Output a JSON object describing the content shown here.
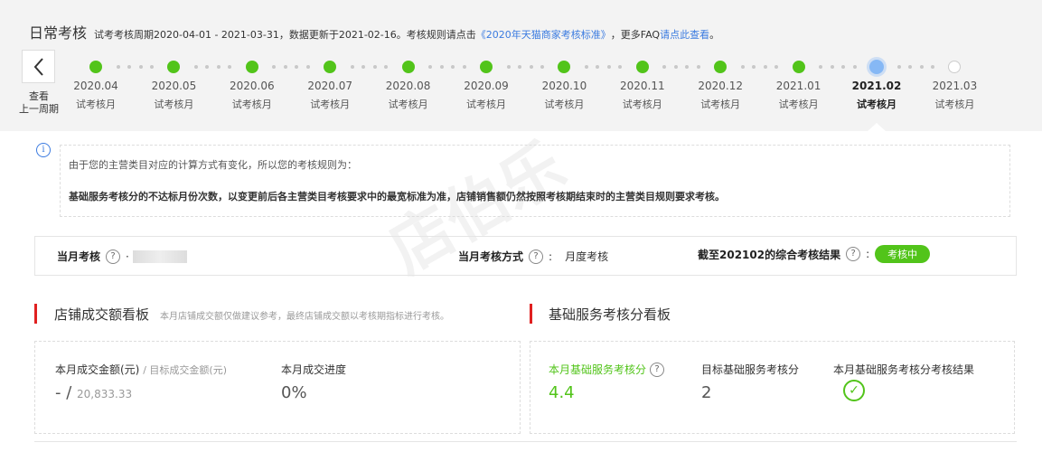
{
  "header": {
    "title": "日常考核",
    "desc_prefix": "试考考核周期2020-04-01 - 2021-03-31，数据更新于2021-02-16。考核规则请点击",
    "link_rules": "《2020年天猫商家考核标准》",
    "desc_mid": "，更多FAQ",
    "link_faq": "请点此查看",
    "desc_end": "。"
  },
  "back": {
    "line1": "查看",
    "line2": "上一周期"
  },
  "timeline": [
    {
      "month": "2020.04",
      "sub": "试考核月",
      "state": "done"
    },
    {
      "month": "2020.05",
      "sub": "试考核月",
      "state": "done"
    },
    {
      "month": "2020.06",
      "sub": "试考核月",
      "state": "done"
    },
    {
      "month": "2020.07",
      "sub": "试考核月",
      "state": "done"
    },
    {
      "month": "2020.08",
      "sub": "试考核月",
      "state": "done"
    },
    {
      "month": "2020.09",
      "sub": "试考核月",
      "state": "done"
    },
    {
      "month": "2020.10",
      "sub": "试考核月",
      "state": "done"
    },
    {
      "month": "2020.11",
      "sub": "试考核月",
      "state": "done"
    },
    {
      "month": "2020.12",
      "sub": "试考核月",
      "state": "done"
    },
    {
      "month": "2021.01",
      "sub": "试考核月",
      "state": "done"
    },
    {
      "month": "2021.02",
      "sub": "试考核月",
      "state": "current"
    },
    {
      "month": "2021.03",
      "sub": "试考核月",
      "state": "future"
    }
  ],
  "info": {
    "line1": "由于您的主营类目对应的计算方式有变化，所以您的考核规则为：",
    "line2": "基础服务考核分的不达标月份次数，以变更前后各主营类目考核要求中的最宽标准为准，店铺销售额仍然按照考核期结束时的主营类目规则要求考核。"
  },
  "stats": {
    "month_check": "当月考核",
    "month_value": "·",
    "mode_label": "当月考核方式",
    "mode_value": "月度考核",
    "result_label": "截至202102的综合考核结果",
    "result_value": "考核中"
  },
  "gmv_board": {
    "title": "店铺成交额看板",
    "subtitle": "本月店铺成交额仅做建议参考，最终店铺成交额以考核期指标进行考核。",
    "amount_label": "本月成交金额(元)",
    "target_label": "/ 目标成交金额(元)",
    "amount_value": "- /",
    "target_value": "20,833.33",
    "progress_label": "本月成交进度",
    "progress_value": "0%"
  },
  "service_board": {
    "title": "基础服务考核分看板",
    "score_label": "本月基础服务考核分",
    "score_value": "4.4",
    "target_label": "目标基础服务考核分",
    "target_value": "2",
    "result_label": "本月基础服务考核分考核结果"
  },
  "watermark": "店伯乐",
  "colors": {
    "green": "#52c41a",
    "red": "#e02020",
    "link": "#3b7be0",
    "current_dot": "#86b8f5"
  }
}
